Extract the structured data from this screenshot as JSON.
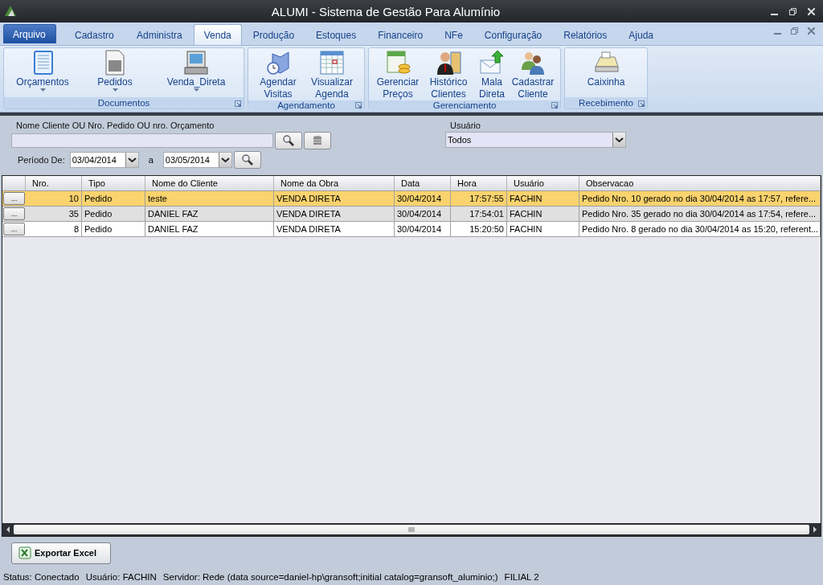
{
  "window": {
    "title": "ALUMI - Sistema de Gestão Para Alumínio"
  },
  "file_menu": "Arquivo",
  "menu_tabs": [
    {
      "label": "Cadastro",
      "selected": false
    },
    {
      "label": "Administra",
      "selected": false
    },
    {
      "label": "Venda",
      "selected": true
    },
    {
      "label": "Produção",
      "selected": false
    },
    {
      "label": "Estoques",
      "selected": false
    },
    {
      "label": "Financeiro",
      "selected": false
    },
    {
      "label": "NFe",
      "selected": false
    },
    {
      "label": "Configuração",
      "selected": false
    },
    {
      "label": "Relatórios",
      "selected": false
    },
    {
      "label": "Ajuda",
      "selected": false
    }
  ],
  "ribbon_groups": [
    {
      "title": "Documentos",
      "items": [
        {
          "label": "Orçamentos",
          "kind": "notebook",
          "dropdown": true
        },
        {
          "label": "Pedidos",
          "kind": "document",
          "dropdown": true
        },
        {
          "label": "Venda_Direta",
          "kind": "register",
          "dropdown": true
        }
      ]
    },
    {
      "title": "Agendamento",
      "items": [
        {
          "label": "Agendar Visitas",
          "kind": "clockbook"
        },
        {
          "label": "Visualizar Agenda",
          "kind": "calendar"
        }
      ]
    },
    {
      "title": "Gerenciamento",
      "items": [
        {
          "label": "Gerenciar Preços",
          "kind": "coins"
        },
        {
          "label": "Histórico Clientes",
          "kind": "person"
        },
        {
          "label": "Mala Direta",
          "kind": "mail"
        },
        {
          "label": "Cadastrar Cliente",
          "kind": "people"
        }
      ]
    },
    {
      "title": "Recebimento",
      "items": [
        {
          "label": "Caixinha",
          "kind": "cashbox"
        }
      ]
    }
  ],
  "filters": {
    "search_label": "Nome Cliente OU Nro. Pedido OU nro. Orçamento",
    "period_label": "Período De:",
    "date_from": "03/04/2014",
    "date_separator": "a",
    "date_to": "03/05/2014",
    "user_label": "Usuário",
    "user_value": "Todos"
  },
  "table": {
    "columns": [
      "Nro.",
      "Tipo",
      "Nome do Cliente",
      "Nome da Obra",
      "Data",
      "Hora",
      "Usuário",
      "Observacao"
    ],
    "rows": [
      {
        "button": "...",
        "cells": [
          "10",
          "Pedido",
          "teste",
          "VENDA DIRETA",
          "30/04/2014",
          "17:57:55",
          "FACHIN",
          "Pedido Nro. 10 gerado no dia 30/04/2014 as 17:57, refere..."
        ],
        "selected": true,
        "hovered": false
      },
      {
        "button": "...",
        "cells": [
          "35",
          "Pedido",
          "DANIEL FAZ",
          "VENDA DIRETA",
          "30/04/2014",
          "17:54:01",
          "FACHIN",
          "Pedido Nro. 35 gerado no dia 30/04/2014 as 17:54, refere..."
        ],
        "selected": false,
        "hovered": true
      },
      {
        "button": "...",
        "cells": [
          "8",
          "Pedido",
          "DANIEL FAZ",
          "VENDA DIRETA",
          "30/04/2014",
          "15:20:50",
          "FACHIN",
          "Pedido Nro. 8 gerado no dia 30/04/2014 as 15:20, referent..."
        ],
        "selected": false,
        "hovered": false
      }
    ]
  },
  "export_button": "Exportar Excel",
  "status_bar": [
    "Status: Conectado",
    "Usuário: FACHIN",
    "Servidor: Rede (data source=daniel-hp\\gransoft;initial catalog=gransoft_aluminio;)",
    "FILIAL 2"
  ]
}
